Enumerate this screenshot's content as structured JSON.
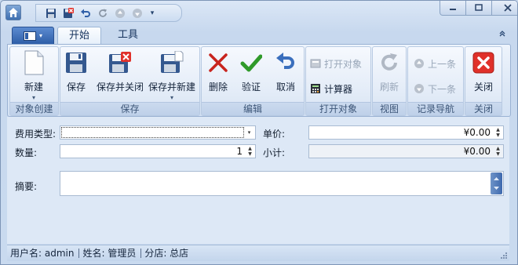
{
  "colors": {
    "accent": "#2e5ea8",
    "ribbon_bg": "#dde8f6",
    "close_red": "#e0312a"
  },
  "qat": {
    "icons": [
      "home-icon",
      "save-icon",
      "save-close-icon",
      "undo-icon",
      "refresh-icon",
      "up-icon",
      "down-icon"
    ]
  },
  "tabs": [
    {
      "label": "开始"
    },
    {
      "label": "工具"
    }
  ],
  "ribbon": {
    "groups": {
      "create": {
        "label": "对象创建",
        "new": "新建"
      },
      "save": {
        "label": "保存",
        "save": "保存",
        "save_close": "保存并关闭",
        "save_new": "保存并新建"
      },
      "edit": {
        "label": "编辑",
        "delete": "删除",
        "validate": "验证",
        "cancel": "取消"
      },
      "open": {
        "label": "打开对象",
        "open_object": "打开对象",
        "calculator": "计算器"
      },
      "view": {
        "label": "视图",
        "refresh": "刷新"
      },
      "nav": {
        "label": "记录导航",
        "prev": "上一条",
        "next": "下一条"
      },
      "close": {
        "label": "关闭",
        "close": "关闭"
      }
    }
  },
  "form": {
    "expense_type": {
      "label": "费用类型:",
      "value": ""
    },
    "unit_price": {
      "label": "单价:",
      "value": "¥0.00"
    },
    "quantity": {
      "label": "数量:",
      "value": "1"
    },
    "subtotal": {
      "label": "小计:",
      "value": "¥0.00"
    },
    "summary": {
      "label": "摘要:",
      "value": ""
    }
  },
  "status": {
    "username": "用户名: admin",
    "name": "姓名: 管理员",
    "branch": "分店: 总店"
  }
}
